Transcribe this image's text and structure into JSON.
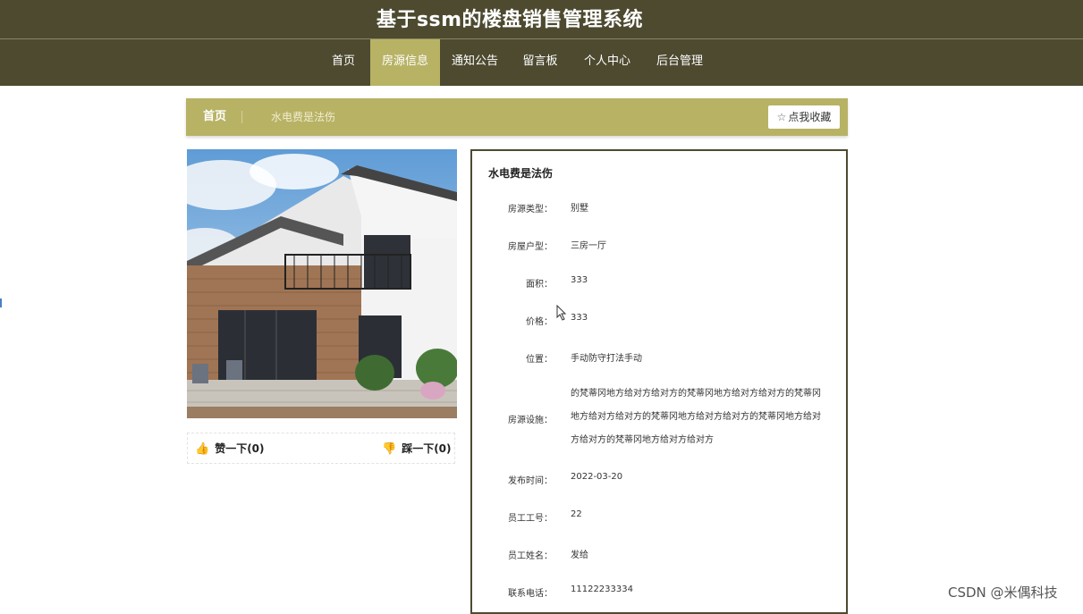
{
  "header": {
    "site_title": "基于ssm的楼盘销售管理系统",
    "nav": [
      {
        "label": "首页",
        "active": false
      },
      {
        "label": "房源信息",
        "active": true
      },
      {
        "label": "通知公告",
        "active": false
      },
      {
        "label": "留言板",
        "active": false
      },
      {
        "label": "个人中心",
        "active": false
      },
      {
        "label": "后台管理",
        "active": false
      }
    ]
  },
  "breadcrumb": {
    "home": "首页",
    "current": "水电费是法伤",
    "favorite_label": "点我收藏"
  },
  "votes": {
    "like_label": "赞一下(0)",
    "dislike_label": "踩一下(0)"
  },
  "detail": {
    "title": "水电费是法伤",
    "fields": [
      {
        "label": "房源类型：",
        "value": "别墅"
      },
      {
        "label": "房屋户型：",
        "value": "三房一厅"
      },
      {
        "label": "面积：",
        "value": "333"
      },
      {
        "label": "价格：",
        "value": "333"
      },
      {
        "label": "位置：",
        "value": "手动防守打法手动"
      },
      {
        "label": "房源设施：",
        "value": "的梵蒂冈地方给对方给对方的梵蒂冈地方给对方给对方的梵蒂冈地方给对方给对方的梵蒂冈地方给对方给对方的梵蒂冈地方给对方给对方的梵蒂冈地方给对方给对方"
      },
      {
        "label": "发布时间：",
        "value": "2022-03-20"
      },
      {
        "label": "员工工号：",
        "value": "22"
      },
      {
        "label": "员工姓名：",
        "value": "发给"
      },
      {
        "label": "联系电话：",
        "value": "11122233334"
      }
    ]
  },
  "watermark": "CSDN @米偶科技",
  "colors": {
    "header_bg": "#4d4a30",
    "accent": "#b8b265",
    "vote_icon": "#e0463a"
  },
  "icons": {
    "favorite": "star-outline-icon",
    "like": "thumbs-up-icon",
    "dislike": "thumbs-down-icon"
  }
}
